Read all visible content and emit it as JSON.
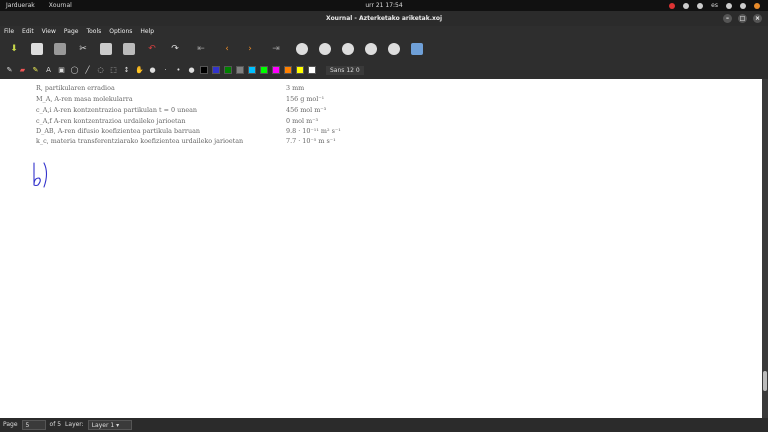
{
  "topbar": {
    "activities": "Jarduerak",
    "app": "Xournal",
    "clock": "urr 21  17:54",
    "lang": "es"
  },
  "window": {
    "title": "Xournal - Azterketako ariketak.xoj"
  },
  "menu": [
    "File",
    "Edit",
    "View",
    "Page",
    "Tools",
    "Options",
    "Help"
  ],
  "toolbar": {
    "font": "Sans 12",
    "font_size": "0",
    "colors": [
      "#000000",
      "#3333cc",
      "#008000",
      "#808080",
      "#00c0ff",
      "#00ff00",
      "#ff00ff",
      "#ff8000",
      "#ffff00",
      "#ffffff"
    ]
  },
  "document": {
    "rows": [
      {
        "label": "R, partikularen erradioa",
        "value": "3 mm"
      },
      {
        "label": "M_A, A-ren masa molekularra",
        "value": "156 g mol⁻¹"
      },
      {
        "label": "c_A,i A-ren kontzentrazioa partikulan t = 0 unean",
        "value": "456 mol m⁻³"
      },
      {
        "label": "c_A,f A-ren kontzentrazioa urdaileko jarioetan",
        "value": "0 mol m⁻³"
      },
      {
        "label": "D_AB, A-ren difusio koefizientea partikula barruan",
        "value": "9.8 · 10⁻¹¹ m² s⁻¹"
      },
      {
        "label": "k_c, materia transferentziarako koefizientea urdaileko jarioetan",
        "value": "7.7 · 10⁻⁵ m s⁻¹"
      }
    ],
    "handwriting": "b)"
  },
  "statusbar": {
    "page_label": "Page",
    "page_value": "5",
    "of_pages": "of 5",
    "layer_label": "Layer:",
    "layer_value": "Layer 1"
  }
}
